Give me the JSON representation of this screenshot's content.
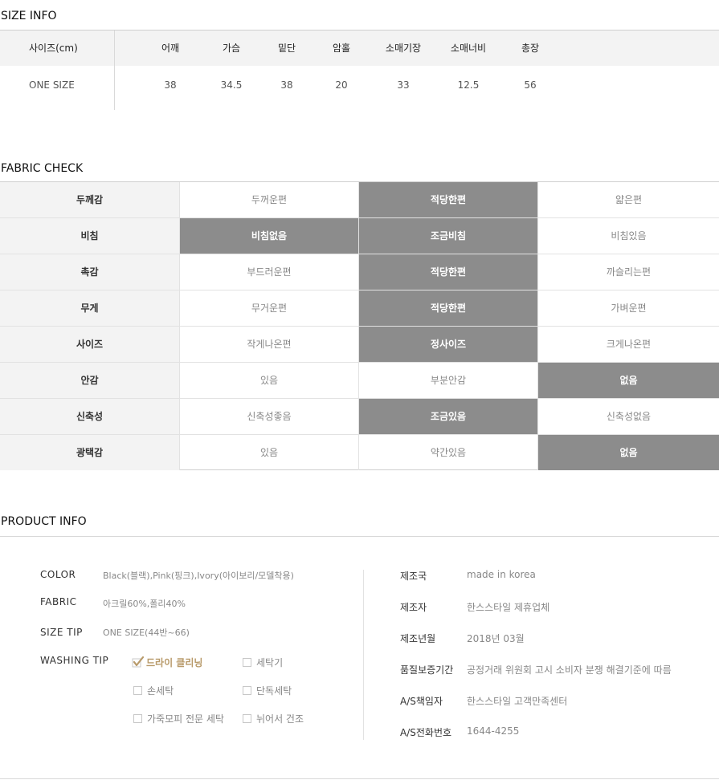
{
  "size_info": {
    "title": "SIZE INFO",
    "label_header": "사이즈(cm)",
    "columns": [
      "어깨",
      "가슴",
      "밑단",
      "암홀",
      "소매기장",
      "소매너비",
      "총장"
    ],
    "rows": [
      {
        "label": "ONE SIZE",
        "values": [
          "38",
          "34.5",
          "38",
          "20",
          "33",
          "12.5",
          "56"
        ]
      }
    ]
  },
  "fabric_check": {
    "title": "FABRIC CHECK",
    "rows": [
      {
        "label": "두께감",
        "options": [
          "두꺼운편",
          "적당한편",
          "얇은편"
        ],
        "selected": [
          1
        ]
      },
      {
        "label": "비침",
        "options": [
          "비침없음",
          "조금비침",
          "비침있음"
        ],
        "selected": [
          0,
          1
        ]
      },
      {
        "label": "촉감",
        "options": [
          "부드러운편",
          "적당한편",
          "까슬리는편"
        ],
        "selected": [
          1
        ]
      },
      {
        "label": "무게",
        "options": [
          "무거운편",
          "적당한편",
          "가벼운편"
        ],
        "selected": [
          1
        ]
      },
      {
        "label": "사이즈",
        "options": [
          "작게나온편",
          "정사이즈",
          "크게나온편"
        ],
        "selected": [
          1
        ]
      },
      {
        "label": "안감",
        "options": [
          "있음",
          "부분안감",
          "없음"
        ],
        "selected": [
          2
        ]
      },
      {
        "label": "신축성",
        "options": [
          "신축성좋음",
          "조금있음",
          "신축성없음"
        ],
        "selected": [
          1
        ]
      },
      {
        "label": "광택감",
        "options": [
          "있음",
          "약간있음",
          "없음"
        ],
        "selected": [
          2
        ]
      }
    ],
    "selected_color": "#8c8c8c"
  },
  "product_info": {
    "title": "PRODUCT INFO",
    "color_label": "COLOR",
    "color_value": "Black(블랙),Pink(핑크),Ivory(아이보리/모델착용)",
    "fabric_label": "FABRIC",
    "fabric_value": "아크릴60%,폴리40%",
    "size_tip_label": "SIZE TIP",
    "size_tip_value": "ONE SIZE(44반~66)",
    "washing_label": "WASHING TIP",
    "washing": {
      "dry_cleaning": "드라이 클리닝",
      "washing_machine": "세탁기",
      "hand_wash": "손세탁",
      "separate_wash": "단독세탁",
      "leather_fur": "가죽모피 전문 세탁",
      "flat_dry": "뉘어서 건조"
    },
    "washing_checked": "dry_cleaning",
    "check_color": "#b89a6a",
    "manufacture": [
      {
        "key": "제조국",
        "value": "made in korea"
      },
      {
        "key": "제조자",
        "value": "한스스타일 제휴업체"
      },
      {
        "key": "제조년월",
        "value": "2018년 03월"
      },
      {
        "key": "품질보증기간",
        "value": "공정거래 위원회 고시 소비자 분쟁 해결기준에 따름"
      },
      {
        "key": "A/S책임자",
        "value": "한스스타일 고객만족센터"
      },
      {
        "key": "A/S전화번호",
        "value": "1644-4255"
      }
    ]
  }
}
